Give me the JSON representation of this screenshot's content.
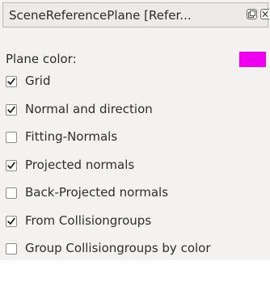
{
  "panel": {
    "title": "SceneReferencePlane [Refer...",
    "float_icon": "float-restore-icon",
    "close_icon": "close-icon"
  },
  "plane_color": {
    "label": "Plane color:",
    "color": "#ee00ee"
  },
  "options": [
    {
      "label": "Grid",
      "checked": true
    },
    {
      "label": "Normal and direction",
      "checked": true
    },
    {
      "label": "Fitting-Normals",
      "checked": false
    },
    {
      "label": "Projected normals",
      "checked": true
    },
    {
      "label": "Back-Projected normals",
      "checked": false
    },
    {
      "label": "From Collisiongroups",
      "checked": true
    },
    {
      "label": "Group Collisiongroups by color",
      "checked": false
    }
  ]
}
